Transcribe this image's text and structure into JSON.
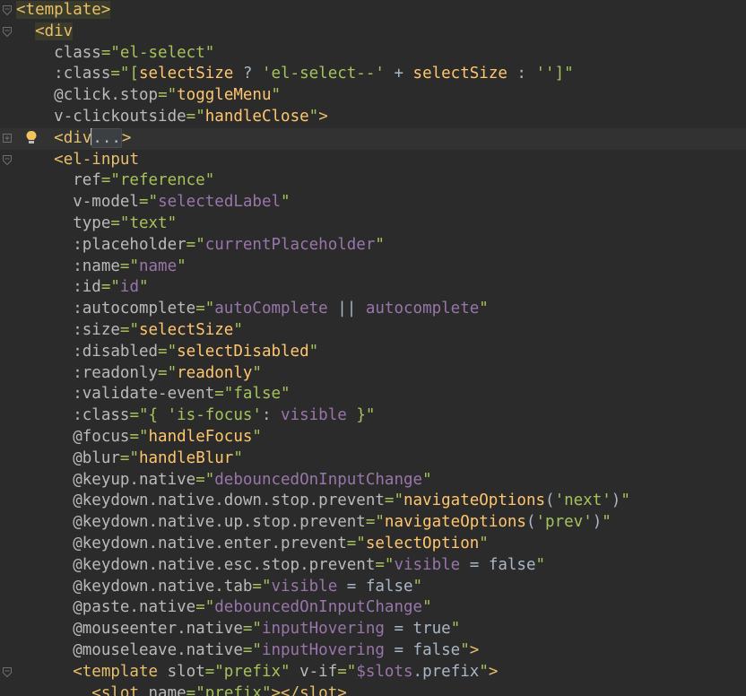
{
  "editor": {
    "language": "vue-template",
    "lines": [
      {
        "fold": "open",
        "tokens": [
          {
            "t": "<template>",
            "c": "tagbg"
          }
        ]
      },
      {
        "fold": "open",
        "tokens": [
          {
            "t": "  "
          },
          {
            "t": "<div",
            "c": "tagbg"
          }
        ]
      },
      {
        "tokens": [
          {
            "t": "    "
          },
          {
            "t": "class",
            "c": "attr"
          },
          {
            "t": "=\"el-select\"",
            "c": "str"
          }
        ]
      },
      {
        "tokens": [
          {
            "t": "    "
          },
          {
            "t": ":class",
            "c": "attr"
          },
          {
            "t": "=\"[",
            "c": "str"
          },
          {
            "t": "selectSize",
            "c": "ref"
          },
          {
            "t": " ? ",
            "c": "plain"
          },
          {
            "t": "'el-select--'",
            "c": "str"
          },
          {
            "t": " + ",
            "c": "plain"
          },
          {
            "t": "selectSize",
            "c": "ref"
          },
          {
            "t": " : ",
            "c": "plain"
          },
          {
            "t": "''",
            "c": "str"
          },
          {
            "t": "]\"",
            "c": "str"
          }
        ]
      },
      {
        "tokens": [
          {
            "t": "    "
          },
          {
            "t": "@click.stop",
            "c": "attr"
          },
          {
            "t": "=\"",
            "c": "str"
          },
          {
            "t": "toggleMenu",
            "c": "ref"
          },
          {
            "t": "\"",
            "c": "str"
          }
        ]
      },
      {
        "tokens": [
          {
            "t": "    "
          },
          {
            "t": "v-clickoutside",
            "c": "attr"
          },
          {
            "t": "=\"",
            "c": "str"
          },
          {
            "t": "handleClose",
            "c": "ref"
          },
          {
            "t": "\"",
            "c": "str"
          },
          {
            "t": ">",
            "c": "tag"
          }
        ]
      },
      {
        "fold": "collapsed",
        "bulb": true,
        "current": true,
        "tokens": [
          {
            "t": "    "
          },
          {
            "t": "<div",
            "c": "tag"
          },
          {
            "t": "CARET"
          },
          {
            "t": "...",
            "c": "coll"
          },
          {
            "t": ">",
            "c": "tag"
          }
        ]
      },
      {
        "fold": "open",
        "tokens": [
          {
            "t": "    "
          },
          {
            "t": "<el-input",
            "c": "tag"
          }
        ]
      },
      {
        "tokens": [
          {
            "t": "      "
          },
          {
            "t": "ref",
            "c": "attr"
          },
          {
            "t": "=\"reference\"",
            "c": "str"
          }
        ]
      },
      {
        "tokens": [
          {
            "t": "      "
          },
          {
            "t": "v-model",
            "c": "attr"
          },
          {
            "t": "=\"",
            "c": "str"
          },
          {
            "t": "selectedLabel",
            "c": "var"
          },
          {
            "t": "\"",
            "c": "str"
          }
        ]
      },
      {
        "tokens": [
          {
            "t": "      "
          },
          {
            "t": "type",
            "c": "attr"
          },
          {
            "t": "=\"text\"",
            "c": "str"
          }
        ]
      },
      {
        "tokens": [
          {
            "t": "      "
          },
          {
            "t": ":placeholder",
            "c": "attr"
          },
          {
            "t": "=\"",
            "c": "str"
          },
          {
            "t": "currentPlaceholder",
            "c": "var"
          },
          {
            "t": "\"",
            "c": "str"
          }
        ]
      },
      {
        "tokens": [
          {
            "t": "      "
          },
          {
            "t": ":name",
            "c": "attr"
          },
          {
            "t": "=\"",
            "c": "str"
          },
          {
            "t": "name",
            "c": "var"
          },
          {
            "t": "\"",
            "c": "str"
          }
        ]
      },
      {
        "tokens": [
          {
            "t": "      "
          },
          {
            "t": ":id",
            "c": "attr"
          },
          {
            "t": "=\"",
            "c": "str"
          },
          {
            "t": "id",
            "c": "var"
          },
          {
            "t": "\"",
            "c": "str"
          }
        ]
      },
      {
        "tokens": [
          {
            "t": "      "
          },
          {
            "t": ":autocomplete",
            "c": "attr"
          },
          {
            "t": "=\"",
            "c": "str"
          },
          {
            "t": "autoComplete",
            "c": "var"
          },
          {
            "t": " || ",
            "c": "plain"
          },
          {
            "t": "autocomplete",
            "c": "var"
          },
          {
            "t": "\"",
            "c": "str"
          }
        ]
      },
      {
        "tokens": [
          {
            "t": "      "
          },
          {
            "t": ":size",
            "c": "attr"
          },
          {
            "t": "=\"",
            "c": "str"
          },
          {
            "t": "selectSize",
            "c": "ref"
          },
          {
            "t": "\"",
            "c": "str"
          }
        ]
      },
      {
        "tokens": [
          {
            "t": "      "
          },
          {
            "t": ":disabled",
            "c": "attr"
          },
          {
            "t": "=\"",
            "c": "str"
          },
          {
            "t": "selectDisabled",
            "c": "ref"
          },
          {
            "t": "\"",
            "c": "str"
          }
        ]
      },
      {
        "tokens": [
          {
            "t": "      "
          },
          {
            "t": ":readonly",
            "c": "attr"
          },
          {
            "t": "=\"",
            "c": "str"
          },
          {
            "t": "readonly",
            "c": "ref"
          },
          {
            "t": "\"",
            "c": "str"
          }
        ]
      },
      {
        "tokens": [
          {
            "t": "      "
          },
          {
            "t": ":validate-event",
            "c": "attr"
          },
          {
            "t": "=\"false\"",
            "c": "str"
          }
        ]
      },
      {
        "tokens": [
          {
            "t": "      "
          },
          {
            "t": ":class",
            "c": "attr"
          },
          {
            "t": "=\"{ ",
            "c": "str"
          },
          {
            "t": "'is-focus'",
            "c": "str"
          },
          {
            "t": ": ",
            "c": "plain"
          },
          {
            "t": "visible",
            "c": "var"
          },
          {
            "t": " }\"",
            "c": "str"
          }
        ]
      },
      {
        "tokens": [
          {
            "t": "      "
          },
          {
            "t": "@focus",
            "c": "attr"
          },
          {
            "t": "=\"",
            "c": "str"
          },
          {
            "t": "handleFocus",
            "c": "ref"
          },
          {
            "t": "\"",
            "c": "str"
          }
        ]
      },
      {
        "tokens": [
          {
            "t": "      "
          },
          {
            "t": "@blur",
            "c": "attr"
          },
          {
            "t": "=\"",
            "c": "str"
          },
          {
            "t": "handleBlur",
            "c": "ref"
          },
          {
            "t": "\"",
            "c": "str"
          }
        ]
      },
      {
        "tokens": [
          {
            "t": "      "
          },
          {
            "t": "@keyup.native",
            "c": "attr"
          },
          {
            "t": "=\"",
            "c": "str"
          },
          {
            "t": "debouncedOnInputChange",
            "c": "var"
          },
          {
            "t": "\"",
            "c": "str"
          }
        ]
      },
      {
        "tokens": [
          {
            "t": "      "
          },
          {
            "t": "@keydown.native.down.stop.prevent",
            "c": "attr"
          },
          {
            "t": "=\"",
            "c": "str"
          },
          {
            "t": "navigateOptions",
            "c": "ref"
          },
          {
            "t": "(",
            "c": "plain"
          },
          {
            "t": "'next'",
            "c": "str"
          },
          {
            "t": ")",
            "c": "plain"
          },
          {
            "t": "\"",
            "c": "str"
          }
        ]
      },
      {
        "tokens": [
          {
            "t": "      "
          },
          {
            "t": "@keydown.native.up.stop.prevent",
            "c": "attr"
          },
          {
            "t": "=\"",
            "c": "str"
          },
          {
            "t": "navigateOptions",
            "c": "ref"
          },
          {
            "t": "(",
            "c": "plain"
          },
          {
            "t": "'prev'",
            "c": "str"
          },
          {
            "t": ")",
            "c": "plain"
          },
          {
            "t": "\"",
            "c": "str"
          }
        ]
      },
      {
        "tokens": [
          {
            "t": "      "
          },
          {
            "t": "@keydown.native.enter.prevent",
            "c": "attr"
          },
          {
            "t": "=\"",
            "c": "str"
          },
          {
            "t": "selectOption",
            "c": "ref"
          },
          {
            "t": "\"",
            "c": "str"
          }
        ]
      },
      {
        "tokens": [
          {
            "t": "      "
          },
          {
            "t": "@keydown.native.esc.stop.prevent",
            "c": "attr"
          },
          {
            "t": "=\"",
            "c": "str"
          },
          {
            "t": "visible",
            "c": "var"
          },
          {
            "t": " = ",
            "c": "plain"
          },
          {
            "t": "false",
            "c": "plain"
          },
          {
            "t": "\"",
            "c": "str"
          }
        ]
      },
      {
        "tokens": [
          {
            "t": "      "
          },
          {
            "t": "@keydown.native.tab",
            "c": "attr"
          },
          {
            "t": "=\"",
            "c": "str"
          },
          {
            "t": "visible",
            "c": "var"
          },
          {
            "t": " = ",
            "c": "plain"
          },
          {
            "t": "false",
            "c": "plain"
          },
          {
            "t": "\"",
            "c": "str"
          }
        ]
      },
      {
        "tokens": [
          {
            "t": "      "
          },
          {
            "t": "@paste.native",
            "c": "attr"
          },
          {
            "t": "=\"",
            "c": "str"
          },
          {
            "t": "debouncedOnInputChange",
            "c": "var"
          },
          {
            "t": "\"",
            "c": "str"
          }
        ]
      },
      {
        "tokens": [
          {
            "t": "      "
          },
          {
            "t": "@mouseenter.native",
            "c": "attr"
          },
          {
            "t": "=\"",
            "c": "str"
          },
          {
            "t": "inputHovering",
            "c": "var"
          },
          {
            "t": " = ",
            "c": "plain"
          },
          {
            "t": "true",
            "c": "plain"
          },
          {
            "t": "\"",
            "c": "str"
          }
        ]
      },
      {
        "tokens": [
          {
            "t": "      "
          },
          {
            "t": "@mouseleave.native",
            "c": "attr"
          },
          {
            "t": "=\"",
            "c": "str"
          },
          {
            "t": "inputHovering",
            "c": "var"
          },
          {
            "t": " = ",
            "c": "plain"
          },
          {
            "t": "false",
            "c": "plain"
          },
          {
            "t": "\"",
            "c": "str"
          },
          {
            "t": ">",
            "c": "tag"
          }
        ]
      },
      {
        "fold": "open",
        "tokens": [
          {
            "t": "      "
          },
          {
            "t": "<template",
            "c": "tag"
          },
          {
            "t": " slot",
            "c": "attr"
          },
          {
            "t": "=\"prefix\"",
            "c": "str"
          },
          {
            "t": " v-if",
            "c": "attr"
          },
          {
            "t": "=\"",
            "c": "str"
          },
          {
            "t": "$slots",
            "c": "var"
          },
          {
            "t": ".prefix",
            "c": "plain"
          },
          {
            "t": "\"",
            "c": "str"
          },
          {
            "t": ">",
            "c": "tag"
          }
        ]
      },
      {
        "tokens": [
          {
            "t": "        "
          },
          {
            "t": "<slot",
            "c": "tag"
          },
          {
            "t": " name",
            "c": "attr"
          },
          {
            "t": "=\"prefix\"",
            "c": "str"
          },
          {
            "t": "></slot>",
            "c": "tag"
          }
        ]
      }
    ]
  },
  "colors": {
    "background": "#2b2b2b",
    "tag": "#e8bf6a",
    "attribute": "#bababa",
    "string": "#a5c25c",
    "method": "#ffc66d",
    "variable": "#9876aa",
    "plain": "#a9b7c6"
  },
  "icons": {
    "fold_open": "fold-open-icon",
    "fold_collapsed": "fold-collapsed-icon",
    "intention": "lightbulb-icon"
  }
}
